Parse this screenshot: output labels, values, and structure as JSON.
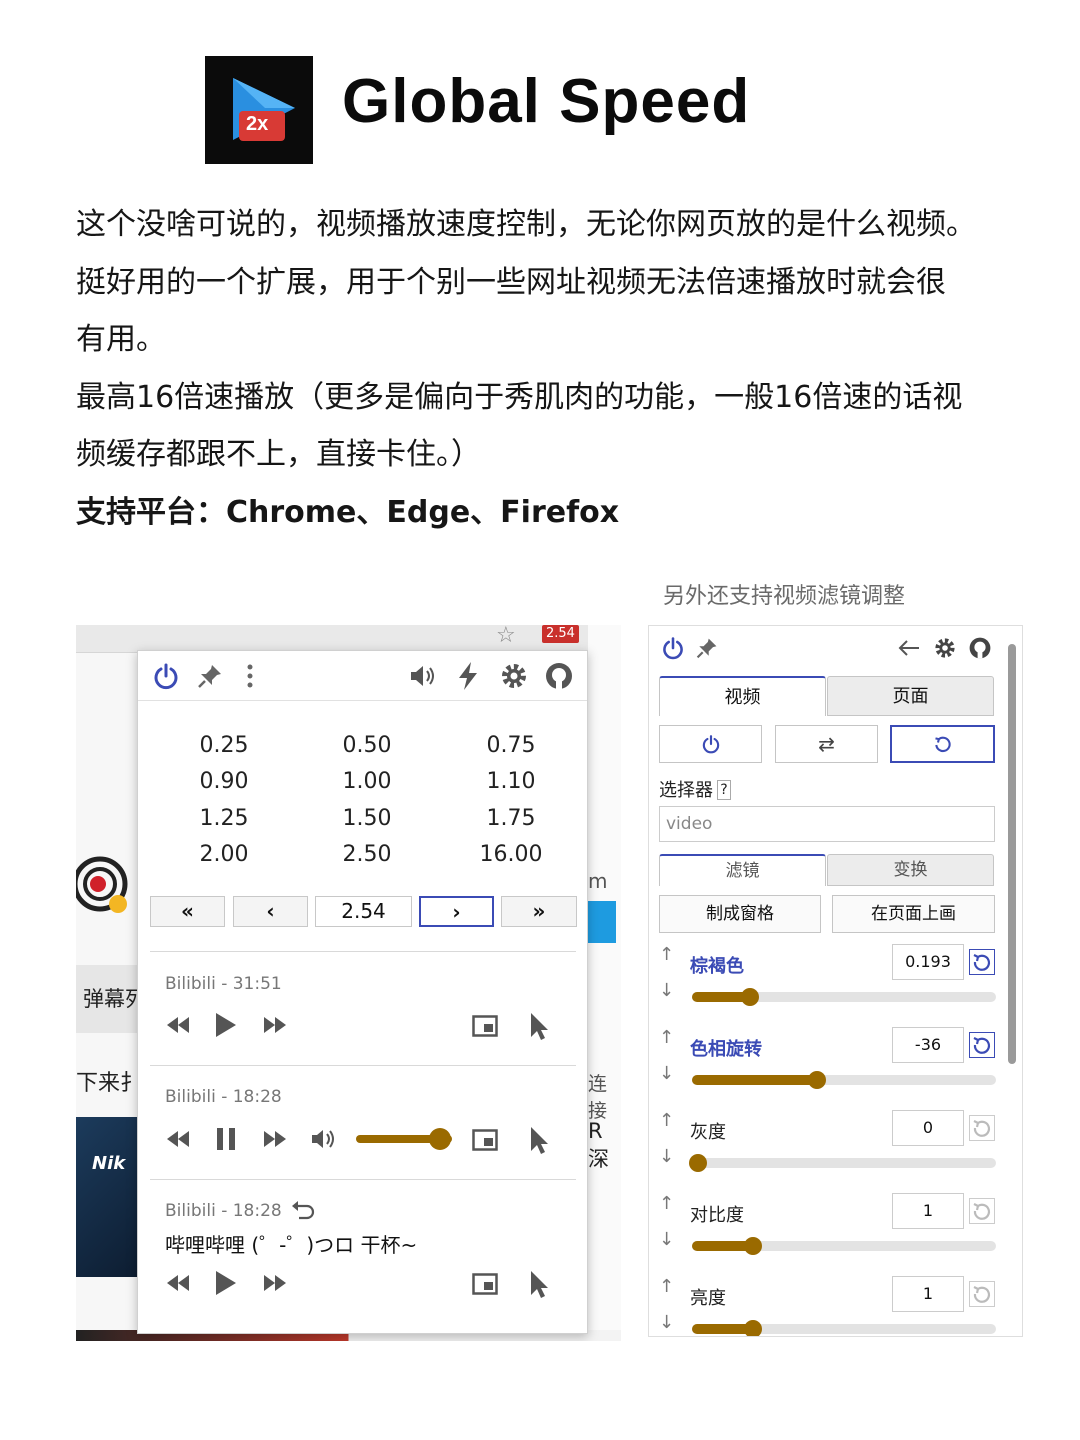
{
  "header": {
    "logo_badge": "2x",
    "title": "Global Speed"
  },
  "description": {
    "lines": [
      "这个没啥可说的，视频播放速度控制，无论你网页放的是什么视频。",
      "挺好用的一个扩展，用于个别一些网址视频无法倍速播放时就会很",
      "有用。",
      "最高16倍速播放（更多是偏向于秀肌肉的功能，一般16倍速的话视",
      "频缓存都跟不上，直接卡住。）"
    ],
    "platform_line": "支持平台：Chrome、Edge、Firefox"
  },
  "right_caption": "另外还支持视频滤镜调整",
  "left_panel": {
    "badge": "2.54",
    "page_fragments": {
      "danmu": "弹幕列",
      "left_text": "下来扌",
      "right_m": "m",
      "right_lian": "连接",
      "right_r": "R深",
      "nikon": "Nik"
    },
    "speeds": [
      [
        "0.25",
        "0.50",
        "0.75"
      ],
      [
        "0.90",
        "1.00",
        "1.10"
      ],
      [
        "1.25",
        "1.50",
        "1.75"
      ],
      [
        "2.00",
        "2.50",
        "16.00"
      ]
    ],
    "current_speed": "2.54",
    "media": [
      {
        "label": "Bilibili - 31:51",
        "playing": false
      },
      {
        "label": "Bilibili - 18:28",
        "playing": true,
        "volume_fraction": 0.88
      },
      {
        "label": "Bilibili - 18:28",
        "title": "哔哩哔哩 (゜-゜)つロ 干杯~",
        "playing": false
      }
    ],
    "icons": [
      "power-icon",
      "pin-icon",
      "more-icon",
      "volume-icon",
      "lightning-icon",
      "gear-icon",
      "github-icon"
    ]
  },
  "right_panel": {
    "tabs": [
      "视频",
      "页面"
    ],
    "selector_label": "选择器",
    "selector_help": "?",
    "selector_value": "video",
    "sub_tabs": [
      "滤镜",
      "变换"
    ],
    "action_buttons": [
      "制成窗格",
      "在页面上画"
    ],
    "filters": [
      {
        "name": "棕褐色",
        "value": "0.193",
        "fraction": 0.19,
        "active": true
      },
      {
        "name": "色相旋转",
        "value": "-36",
        "fraction": 0.41,
        "active": true
      },
      {
        "name": "灰度",
        "value": "0",
        "fraction": 0.0,
        "active": false
      },
      {
        "name": "对比度",
        "value": "1",
        "fraction": 0.2,
        "active": false
      },
      {
        "name": "亮度",
        "value": "1",
        "fraction": 0.2,
        "active": false
      }
    ],
    "accent": "#3b4bb5",
    "slider_color": "#9a6a00"
  }
}
